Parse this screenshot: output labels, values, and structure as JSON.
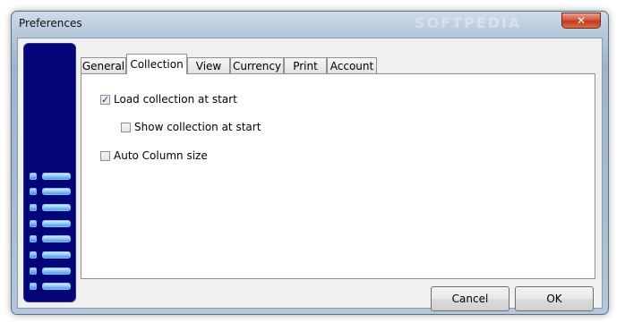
{
  "window": {
    "title": "Preferences",
    "close_label": "✕"
  },
  "watermark": "SOFTPEDIA",
  "tabs": [
    {
      "label": "General",
      "active": false
    },
    {
      "label": "Collection",
      "active": true
    },
    {
      "label": "View",
      "active": false
    },
    {
      "label": "Currency",
      "active": false
    },
    {
      "label": "Print",
      "active": false
    },
    {
      "label": "Account",
      "active": false
    }
  ],
  "options": {
    "load_collection": {
      "label": "Load collection at start",
      "checked": true
    },
    "show_collection": {
      "label": "Show collection at start",
      "checked": false
    },
    "auto_column": {
      "label": "Auto Column size",
      "checked": false
    }
  },
  "buttons": {
    "cancel": "Cancel",
    "ok": "OK"
  },
  "colors": {
    "side_panel": "#05057a",
    "close_button": "#c0381c"
  }
}
